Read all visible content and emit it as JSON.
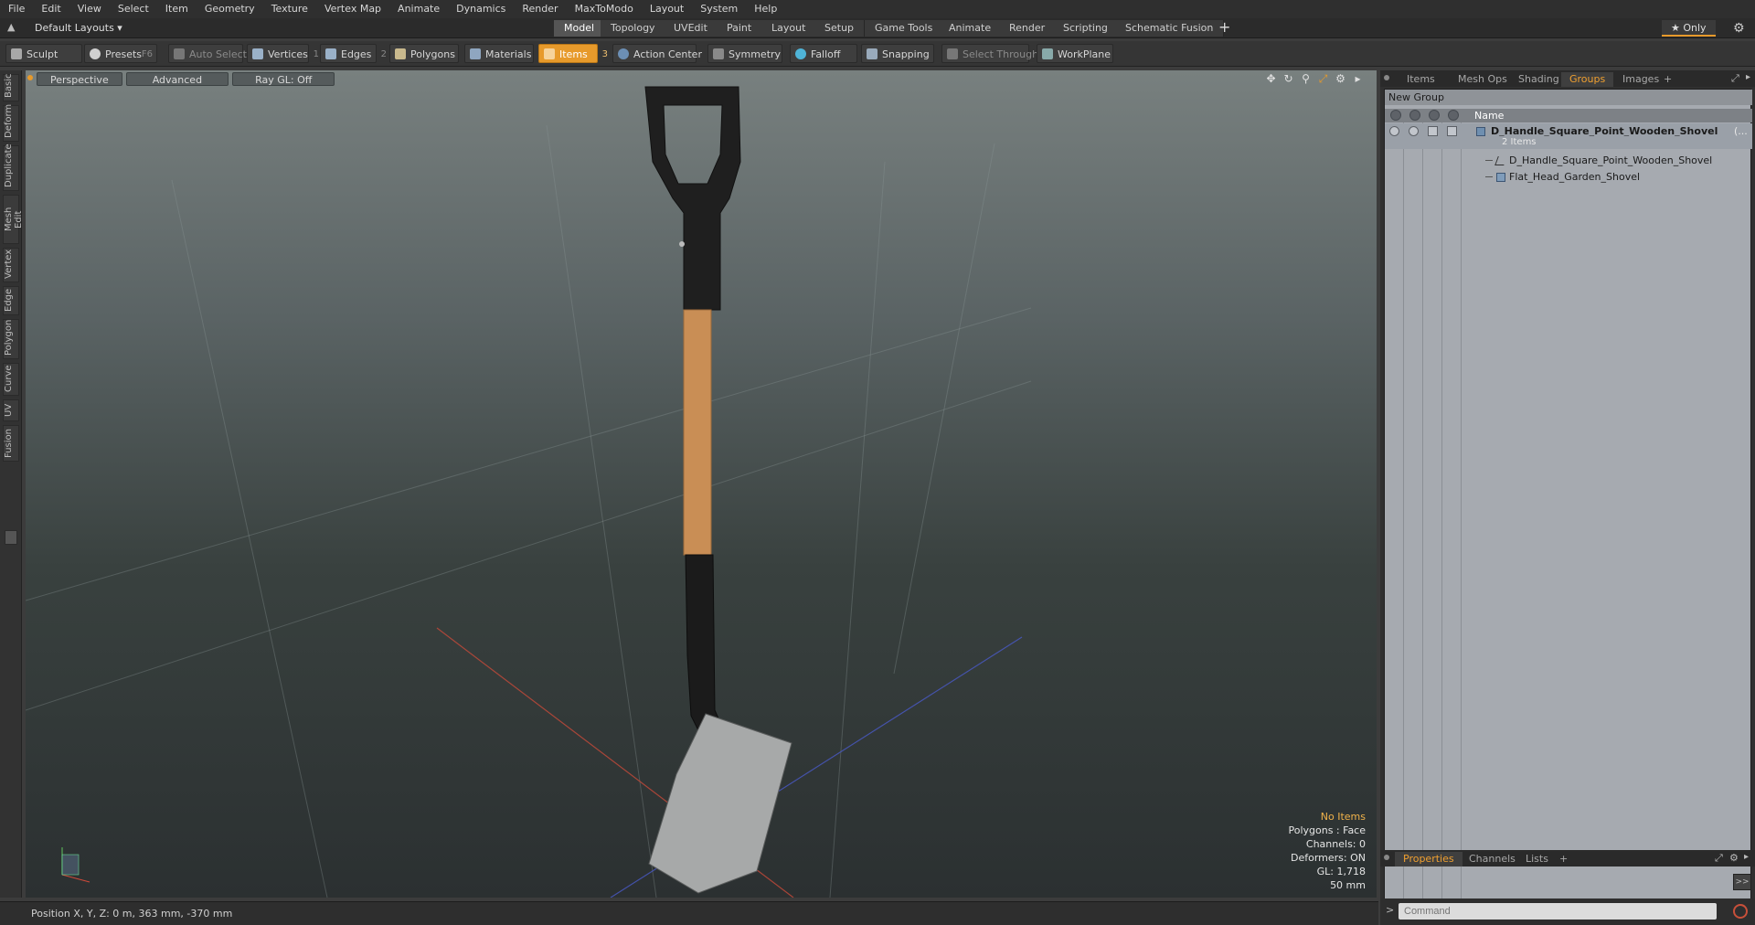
{
  "menu": [
    "File",
    "Edit",
    "View",
    "Select",
    "Item",
    "Geometry",
    "Texture",
    "Vertex Map",
    "Animate",
    "Dynamics",
    "Render",
    "MaxToModo",
    "Layout",
    "System",
    "Help"
  ],
  "layout_selector": "Default Layouts ▾",
  "layout_tabs": [
    "Model",
    "Topology",
    "UVEdit",
    "Paint",
    "Layout",
    "Setup",
    "Game Tools",
    "Animate",
    "Render",
    "Scripting",
    "Schematic Fusion"
  ],
  "layout_tab_active": "Model",
  "layout_plus": "+",
  "only_label": "★ Only",
  "toolbar": {
    "sculpt": "Sculpt",
    "presets": "Presets",
    "presets_key": "F6",
    "auto_select": "Auto Select",
    "vertices": "Vertices",
    "vertices_count": "1",
    "edges": "Edges",
    "edges_count": "2",
    "polygons": "Polygons",
    "materials": "Materials",
    "items": "Items",
    "items_count": "3",
    "action_center": "Action Center",
    "symmetry": "Symmetry",
    "falloff": "Falloff",
    "snapping": "Snapping",
    "select_through": "Select Through",
    "workplane": "WorkPlane"
  },
  "left_tabs": [
    "Basic",
    "Deform",
    "Duplicate",
    "Mesh Edit",
    "Vertex",
    "Edge",
    "Polygon",
    "Curve",
    "UV",
    "Fusion"
  ],
  "viewport": {
    "view_mode": "Perspective",
    "shading": "Advanced",
    "raygl": "Ray GL: Off",
    "stats": {
      "no_items": "No Items",
      "polygons": "Polygons : Face",
      "channels": "Channels: 0",
      "deformers": "Deformers: ON",
      "gl": "GL: 1,718",
      "scale": "50 mm"
    }
  },
  "status": {
    "position": "Position X, Y, Z:   0 m, 363 mm, -370 mm"
  },
  "right_panel": {
    "tabs": [
      "Items",
      "Mesh Ops",
      "Shading",
      "Groups",
      "Images"
    ],
    "active_tab": "Groups",
    "plus": "+",
    "new_group": "New Group",
    "column_name": "Name",
    "group_name": "D_Handle_Square_Point_Wooden_Shovel",
    "group_suffix": "(...",
    "group_count": "2 Items",
    "children": [
      "D_Handle_Square_Point_Wooden_Shovel",
      "Flat_Head_Garden_Shovel"
    ],
    "bottom_tabs": [
      "Properties",
      "Channels",
      "Lists"
    ],
    "bottom_active": "Properties",
    "bottom_plus": "+",
    "expand": ">>",
    "command_placeholder": "Command"
  },
  "colors": {
    "accent": "#e79a2b",
    "warn_text": "#f0b24a"
  }
}
